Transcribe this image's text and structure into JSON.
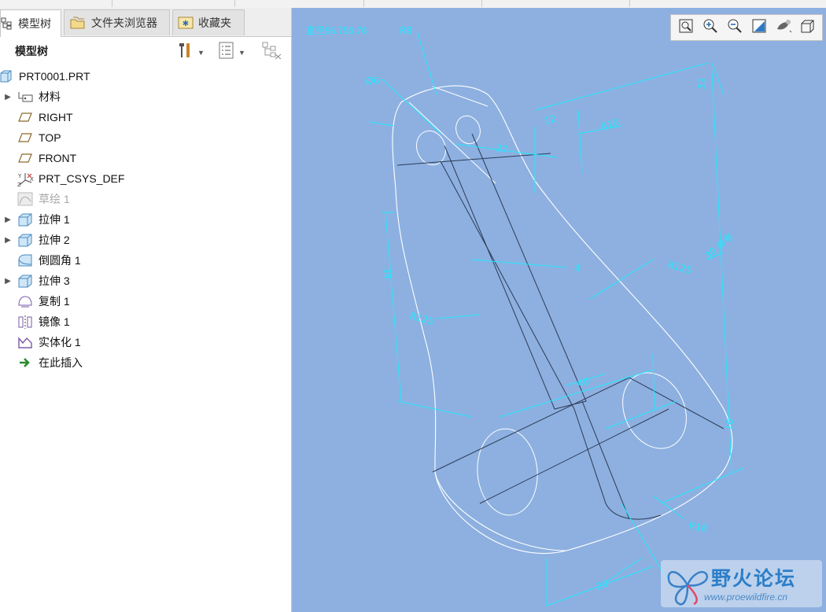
{
  "tabs": [
    {
      "label": "模型树",
      "active": true
    },
    {
      "label": "文件夹浏览器",
      "active": false
    },
    {
      "label": "收藏夹",
      "active": false
    }
  ],
  "subtoolbar": {
    "title": "模型树"
  },
  "tree": {
    "root": "PRT0001.PRT",
    "items": [
      {
        "label": "材料",
        "expandable": true,
        "icon": "material-icon",
        "dim": false
      },
      {
        "label": "RIGHT",
        "expandable": false,
        "icon": "datum-plane-icon",
        "dim": false
      },
      {
        "label": "TOP",
        "expandable": false,
        "icon": "datum-plane-icon",
        "dim": false
      },
      {
        "label": "FRONT",
        "expandable": false,
        "icon": "datum-plane-icon",
        "dim": false
      },
      {
        "label": "PRT_CSYS_DEF",
        "expandable": false,
        "icon": "csys-icon",
        "dim": false
      },
      {
        "label": "草绘 1",
        "expandable": false,
        "icon": "sketch-icon",
        "dim": true
      },
      {
        "label": "拉伸 1",
        "expandable": true,
        "icon": "extrude-icon",
        "dim": false
      },
      {
        "label": "拉伸 2",
        "expandable": true,
        "icon": "extrude-icon",
        "dim": false
      },
      {
        "label": "倒圆角 1",
        "expandable": false,
        "icon": "round-icon",
        "dim": false
      },
      {
        "label": "拉伸 3",
        "expandable": true,
        "icon": "extrude-icon",
        "dim": false
      },
      {
        "label": "复制 1",
        "expandable": false,
        "icon": "copy-icon",
        "dim": false
      },
      {
        "label": "镜像 1",
        "expandable": false,
        "icon": "mirror-icon",
        "dim": false
      },
      {
        "label": "实体化 1",
        "expandable": false,
        "icon": "solidify-icon",
        "dim": false
      },
      {
        "label": "在此插入",
        "expandable": false,
        "icon": "insert-here-arrow-icon",
        "dim": false
      }
    ]
  },
  "viewport": {
    "measure_text": "直径56.756 76",
    "dimensions": [
      "R8",
      "Ø6",
      "12",
      "R10",
      "27",
      "33",
      "4",
      "R125",
      "R125",
      "34",
      "30 参考",
      "R125",
      "40",
      "10",
      "R18",
      "20"
    ]
  },
  "watermark": {
    "name": "野火论坛",
    "url": "www.proewildfire.cn"
  },
  "colors": {
    "viewport_bg": "#8db0e0",
    "dimension": "#23e8ff",
    "edge_white": "#ffffff",
    "edge_dark": "#2d3a55"
  }
}
